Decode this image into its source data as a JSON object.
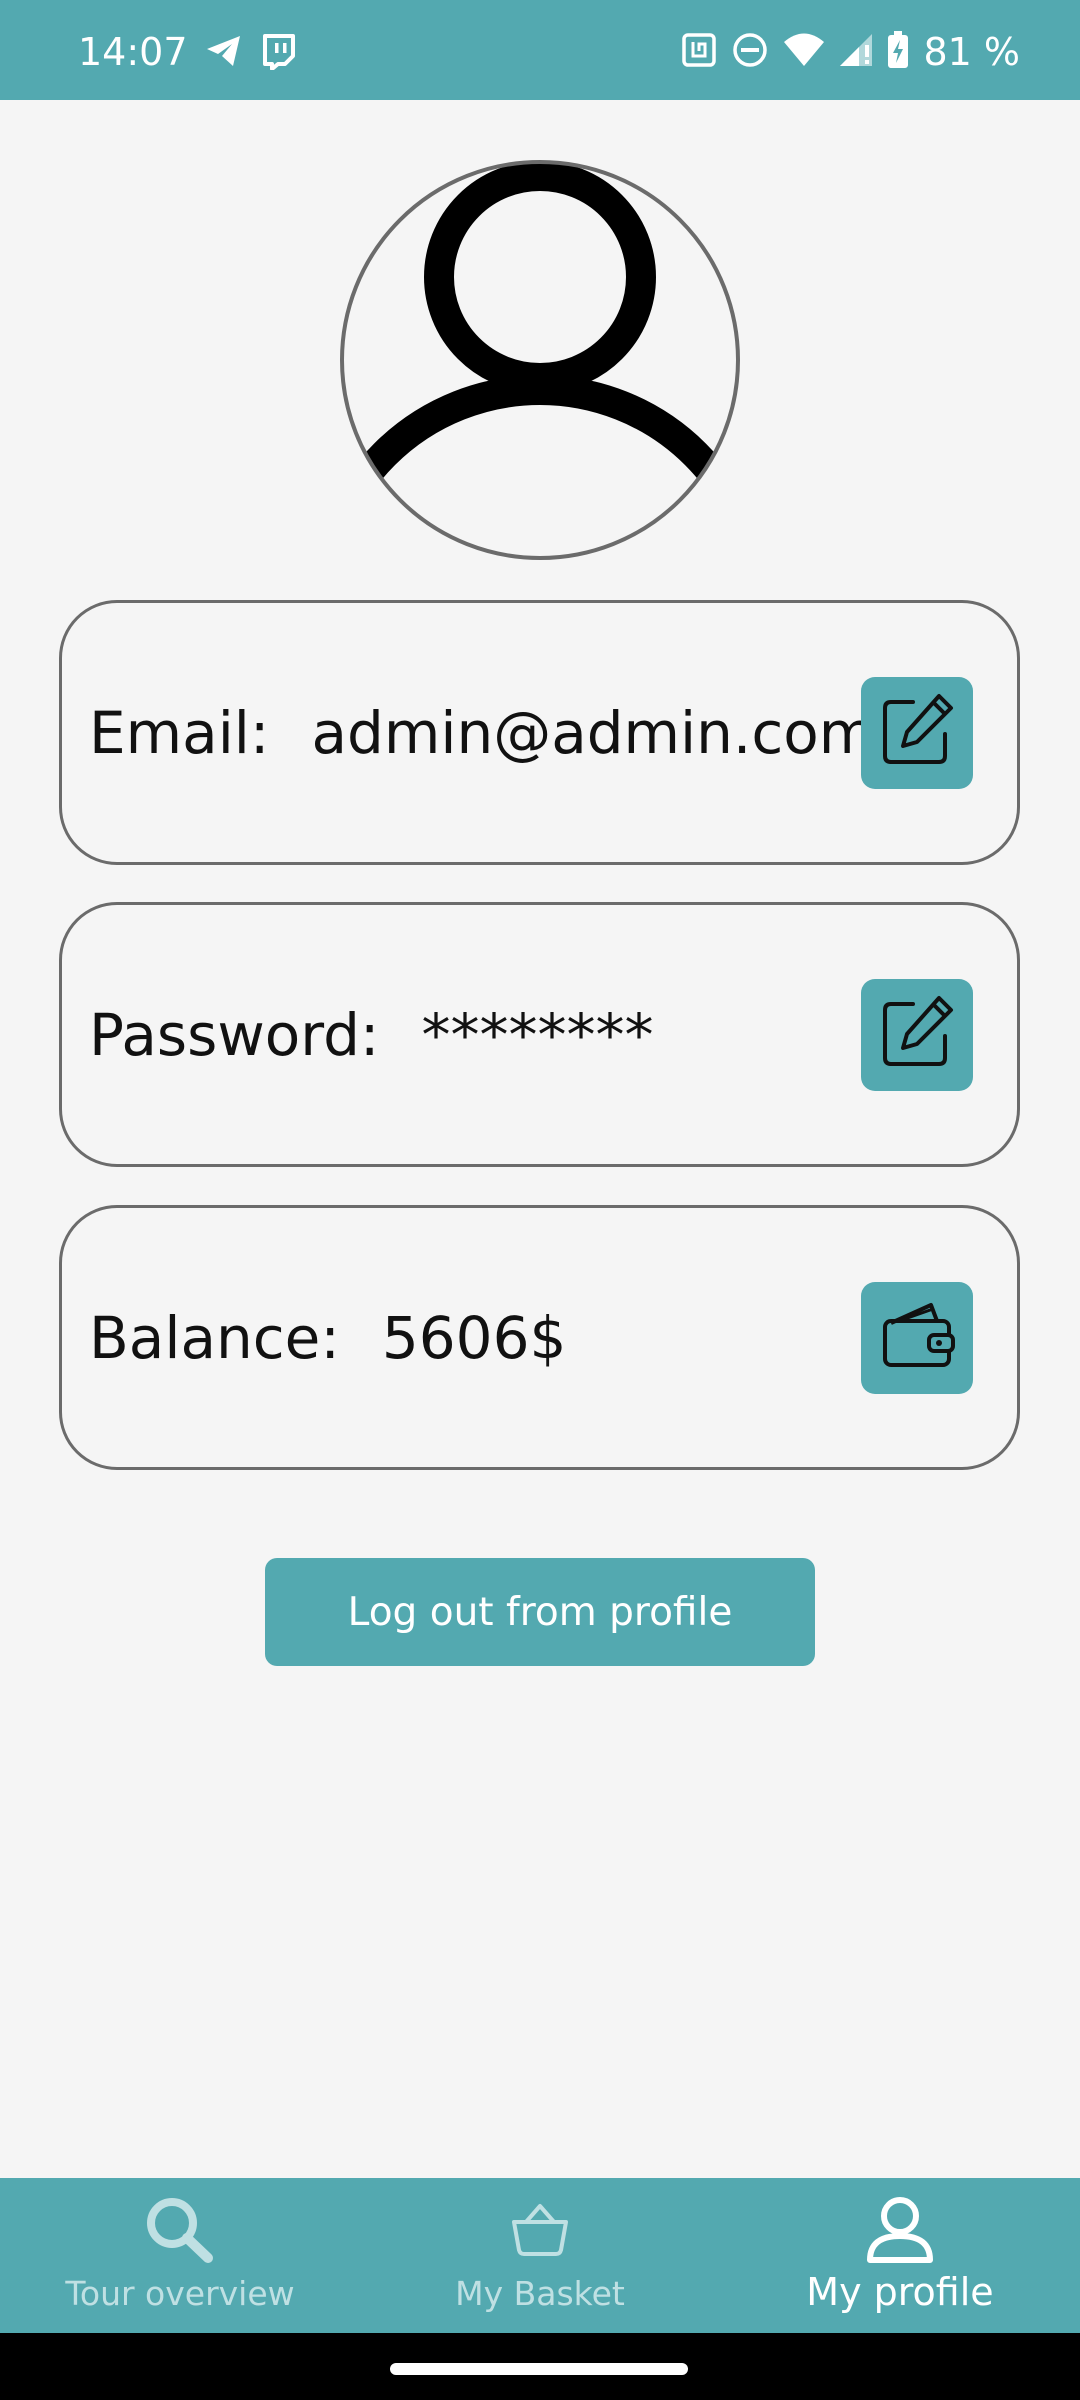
{
  "status_bar": {
    "time": "14:07",
    "battery": "81 %"
  },
  "profile": {
    "email_label": "Email:",
    "email_value": "admin@admin.com",
    "password_label": "Password:",
    "password_value": "********",
    "balance_label": "Balance:",
    "balance_value": "5606$"
  },
  "actions": {
    "logout_label": "Log out from profile"
  },
  "bottom_nav": {
    "items": [
      {
        "label": "Tour overview",
        "icon": "search-icon"
      },
      {
        "label": "My Basket",
        "icon": "basket-icon"
      },
      {
        "label": "My profile",
        "icon": "person-icon"
      }
    ],
    "active_index": 2
  },
  "colors": {
    "accent": "#53a9b0",
    "background": "#f5f5f5",
    "card_border": "#6b6b6b"
  }
}
